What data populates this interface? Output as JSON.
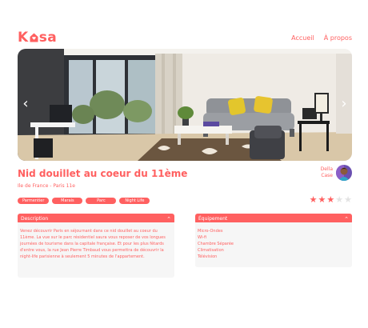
{
  "header": {
    "logo_pre": "K",
    "logo_post": "sa",
    "nav": [
      {
        "label": "Accueil"
      },
      {
        "label": "À propos"
      }
    ]
  },
  "carousel": {
    "prev_glyph": "‹",
    "next_glyph": "›"
  },
  "listing": {
    "title": "Nid douillet au coeur du 11ème",
    "location": "Ile de France - Paris 11e",
    "host_first": "Della",
    "host_last": "Case",
    "tags": [
      "Parmentier",
      "Marais",
      "Parc",
      "Night Life"
    ],
    "rating": 3,
    "rating_max": 5
  },
  "description": {
    "title": "Description",
    "text": "Venez découvrir Paris en séjournant dans ce nid douillet au coeur du 11ème. La vue sur le parc résidentiel saura vous reposer de vos longues journées de tourisme dans la capitale française. Et pour les plus fêtards d'entre vous, la rue Jean Pierre Timbaud vous permettra de découvrir la night-life parisienne à seulement 5 minutes de l'appartement."
  },
  "equipment": {
    "title": "Équipement",
    "items": [
      "Micro-Ondes",
      "Wi-fi",
      "Chambre Séparée",
      "Climatisation",
      "Télévision"
    ]
  },
  "colors": {
    "accent": "#ff6060",
    "panel": "#f6f6f6",
    "star_off": "#e3e3e3"
  }
}
